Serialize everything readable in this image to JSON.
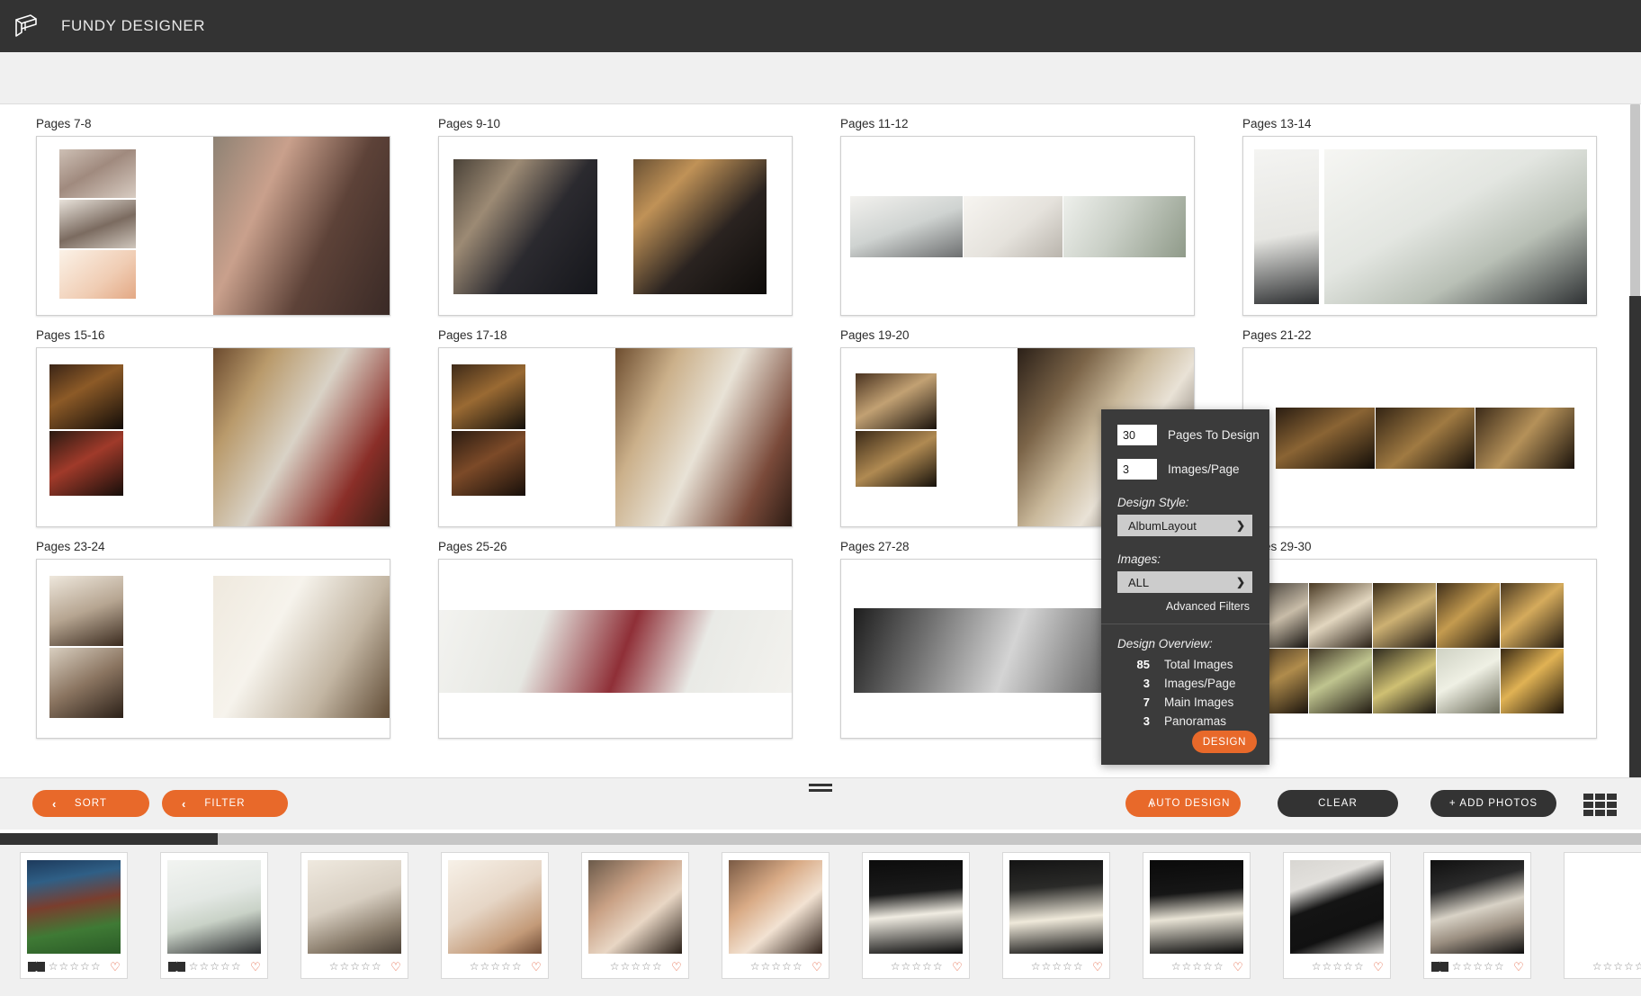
{
  "app": {
    "title": "FUNDY DESIGNER",
    "logo_icon": "fundy-logo-icon",
    "accent_color": "#e8692a",
    "header_bg": "#333333"
  },
  "spreads": [
    {
      "label": "Pages 7-8",
      "layout": "stack3-left-full-right"
    },
    {
      "label": "Pages 9-10",
      "layout": "two-center"
    },
    {
      "label": "Pages 11-12",
      "layout": "pano-three-center"
    },
    {
      "label": "Pages 13-14",
      "layout": "tall-left-wide-right"
    },
    {
      "label": "Pages 15-16",
      "layout": "stack2-left-full-right"
    },
    {
      "label": "Pages 17-18",
      "layout": "grid2-left-full-right"
    },
    {
      "label": "Pages 19-20",
      "layout": "stack2-left-full-right"
    },
    {
      "label": "Pages 21-22",
      "layout": "three-row-center"
    },
    {
      "label": "Pages 23-24",
      "layout": "stack2-left-full-right"
    },
    {
      "label": "Pages 25-26",
      "layout": "pano-center"
    },
    {
      "label": "Pages 27-28",
      "layout": "bw-pano-center"
    },
    {
      "label": "Pages 29-30",
      "layout": "grid-5x2"
    }
  ],
  "design_popup": {
    "pages_to_design_value": "30",
    "pages_to_design_label": "Pages To Design",
    "images_per_page_value": "3",
    "images_per_page_label": "Images/Page",
    "design_style_label": "Design Style:",
    "design_style_value": "AlbumLayout",
    "images_label": "Images:",
    "images_value": "ALL",
    "advanced_filters": "Advanced Filters",
    "overview_title": "Design Overview:",
    "stats": [
      {
        "value": "85",
        "label": "Total Images"
      },
      {
        "value": "3",
        "label": "Images/Page"
      },
      {
        "value": "7",
        "label": "Main Images"
      },
      {
        "value": "3",
        "label": "Panoramas"
      }
    ],
    "design_button": "DESIGN",
    "chevron": "❯"
  },
  "toolbar": {
    "sort": "SORT",
    "filter": "FILTER",
    "auto_design": "AUTO DESIGN",
    "clear": "CLEAR",
    "add_photos": "+ ADD PHOTOS",
    "back_arrow": "‹",
    "up_caret": "∧",
    "grid_view_icon": "grid-view-icon",
    "drag_handle_icon": "drag-handle-icon"
  },
  "filmstrip": {
    "star_glyph": "☆",
    "heart_glyph": "♡",
    "star_count": 5,
    "thumbnails": [
      {
        "name": "mansion-garden-bride",
        "in_album": true,
        "rating": 0
      },
      {
        "name": "couple-conservatory",
        "in_album": true,
        "rating": 0
      },
      {
        "name": "wedding-dress-window",
        "in_album": false,
        "rating": 0
      },
      {
        "name": "bride-veil-portrait",
        "in_album": false,
        "rating": 0
      },
      {
        "name": "bride-earring-detail",
        "in_album": false,
        "rating": 0
      },
      {
        "name": "bride-smiling-portrait",
        "in_album": false,
        "rating": 0
      },
      {
        "name": "white-bouquet-tall",
        "in_album": false,
        "rating": 0
      },
      {
        "name": "white-bouquet-round",
        "in_album": false,
        "rating": 0
      },
      {
        "name": "bouquet-dark-bg",
        "in_album": false,
        "rating": 0
      },
      {
        "name": "wedding-rings-box",
        "in_album": false,
        "rating": 0
      },
      {
        "name": "bridal-shoes-glitter",
        "in_album": true,
        "rating": 0
      },
      {
        "name": "invitation-suite-bow",
        "in_album": false,
        "rating": 0
      }
    ]
  }
}
